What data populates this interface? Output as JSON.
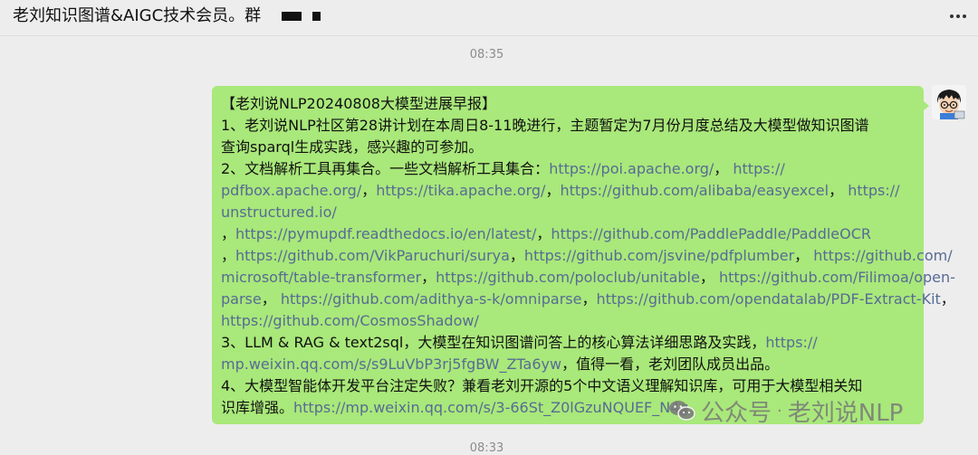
{
  "header": {
    "title": "老刘知识图谱&AIGC技术会员。群",
    "more_label": "more-options"
  },
  "timestamps": [
    "08:35",
    "08:33"
  ],
  "message": {
    "line1": "【老刘说NLP20240808大模型进展早报】",
    "line2": " 1、老刘说NLP社区第28讲计划在本周日8-11晚进行，主题暂定为7月份月度总结及大模型做知识图谱",
    "line3": "查询sparql生成实践，感兴趣的可参加。",
    "line4_text": "2、文档解析工具再集合。一些文档解析工具集合：",
    "line4_link1": "https://poi.apache.org/",
    "line4_sep": "，",
    "line4_link2": "https://",
    "line5_link1": "pdfbox.apache.org/",
    "line5_sep1": "，",
    "line5_link2": "https://tika.apache.org/",
    "line5_sep2": "，",
    "line5_link3": "https://github.com/alibaba/easyexcel",
    "line5_sep3": "，",
    "line5_link4": "https://",
    "line6_link": "unstructured.io/",
    "line7_sep1": "，",
    "line7_link1": "https://pymupdf.readthedocs.io/en/latest/",
    "line7_sep2": "，",
    "line7_link2": "https://github.com/PaddlePaddle/PaddleOCR",
    "line8_sep1": "，",
    "line8_link1": "https://github.com/VikParuchuri/surya",
    "line8_sep2": "，",
    "line8_link2": "https://github.com/jsvine/pdfplumber",
    "line8_sep3": "，",
    "line8_link3": "https://github.com/",
    "line9_link1": "microsoft/table-transformer",
    "line9_sep1": "，",
    "line9_link2": "https://github.com/poloclub/unitable",
    "line9_sep2": "，",
    "line9_link3": "https://github.com/Filimoa/open-",
    "line10_link1": "parse",
    "line10_sep1": "，",
    "line10_link2": "https://github.com/adithya-s-k/omniparse",
    "line10_sep2": "，",
    "line10_link3": "https://github.com/opendatalab/PDF-Extract-Kit",
    "line10_sep3": "，",
    "line11_link": "https://github.com/CosmosShadow/",
    "line12_text": "3、LLM & RAG & text2sql，大模型在知识图谱问答上的核心算法详细思路及实践，",
    "line12_link": "https://",
    "line13_link": "mp.weixin.qq.com/s/s9LuVbP3rj5fgBW_ZTa6yw",
    "line13_text": "，值得一看，老刘团队成员出品。",
    "line14": "4、大模型智能体开发平台注定失败？兼看老刘开源的5个中文语义理解知识库，可用于大模型相关知",
    "line15_text": "识库增强。",
    "line15_link": "https://mp.weixin.qq.com/s/3-66St_Z0lGzuNQUEF_N4g"
  },
  "watermark": {
    "brand": "公众号",
    "dot": "·",
    "name": "老刘说NLP"
  }
}
